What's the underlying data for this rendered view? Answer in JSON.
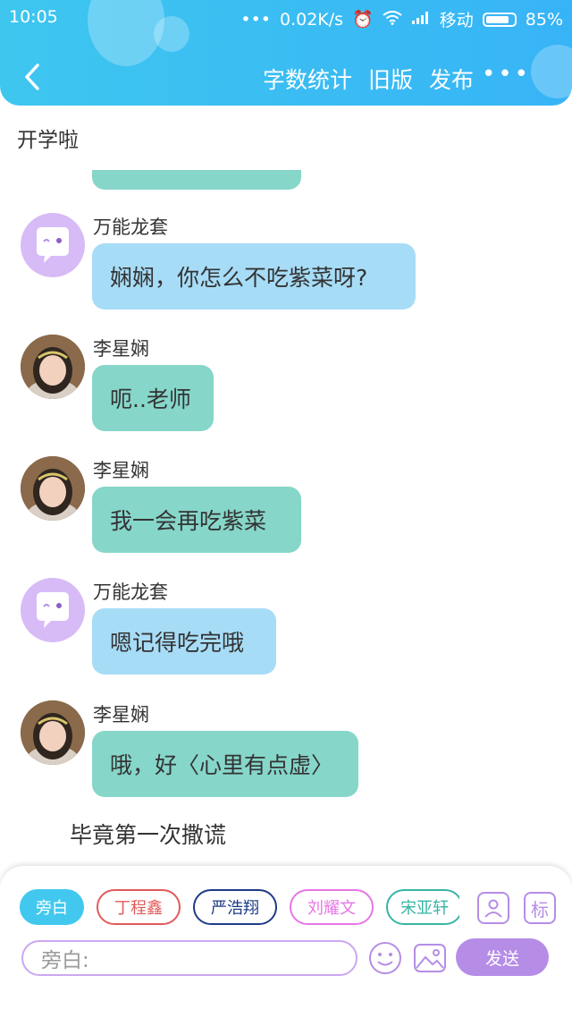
{
  "status_bar": {
    "time": "10:05",
    "signal_dots": "•••",
    "speed": "0.02K/s",
    "carrier": "移动",
    "battery": "85%",
    "battery_level": 0.85
  },
  "nav": {
    "word_count": "字数统计",
    "old_version": "旧版",
    "publish": "发布",
    "more": "•••"
  },
  "story_title": "开学啦",
  "messages": [
    {
      "speaker": "万能龙套",
      "text": "娴娴，你怎么不吃紫菜呀?",
      "avatar": "robot-avatar",
      "bubble_color": "#a7dcf7"
    },
    {
      "speaker": "李星娴",
      "text": "呃..老师",
      "avatar": "girl-avatar",
      "bubble_color": "#86d6c9"
    },
    {
      "speaker": "李星娴",
      "text": "我一会再吃紫菜",
      "avatar": "girl-avatar",
      "bubble_color": "#86d6c9"
    },
    {
      "speaker": "万能龙套",
      "text": "嗯记得吃完哦",
      "avatar": "robot-avatar",
      "bubble_color": "#a7dcf7"
    },
    {
      "speaker": "李星娴",
      "text": "哦，好〈心里有点虚〉",
      "avatar": "girl-avatar",
      "bubble_color": "#86d6c9"
    }
  ],
  "narration": "毕竟第一次撒谎",
  "composer": {
    "characters": [
      {
        "label": "旁白",
        "color": "#42c8ef",
        "selected": true
      },
      {
        "label": "丁程鑫",
        "color": "#e25a5a",
        "selected": false
      },
      {
        "label": "严浩翔",
        "color": "#1f3b86",
        "selected": false
      },
      {
        "label": "刘耀文",
        "color": "#e676e6",
        "selected": false
      },
      {
        "label": "宋亚轩",
        "color": "#38b5a5",
        "selected": false
      }
    ],
    "mark_label": "标",
    "input_placeholder": "旁白:",
    "send_label": "发送",
    "accent": "#b58de6"
  }
}
